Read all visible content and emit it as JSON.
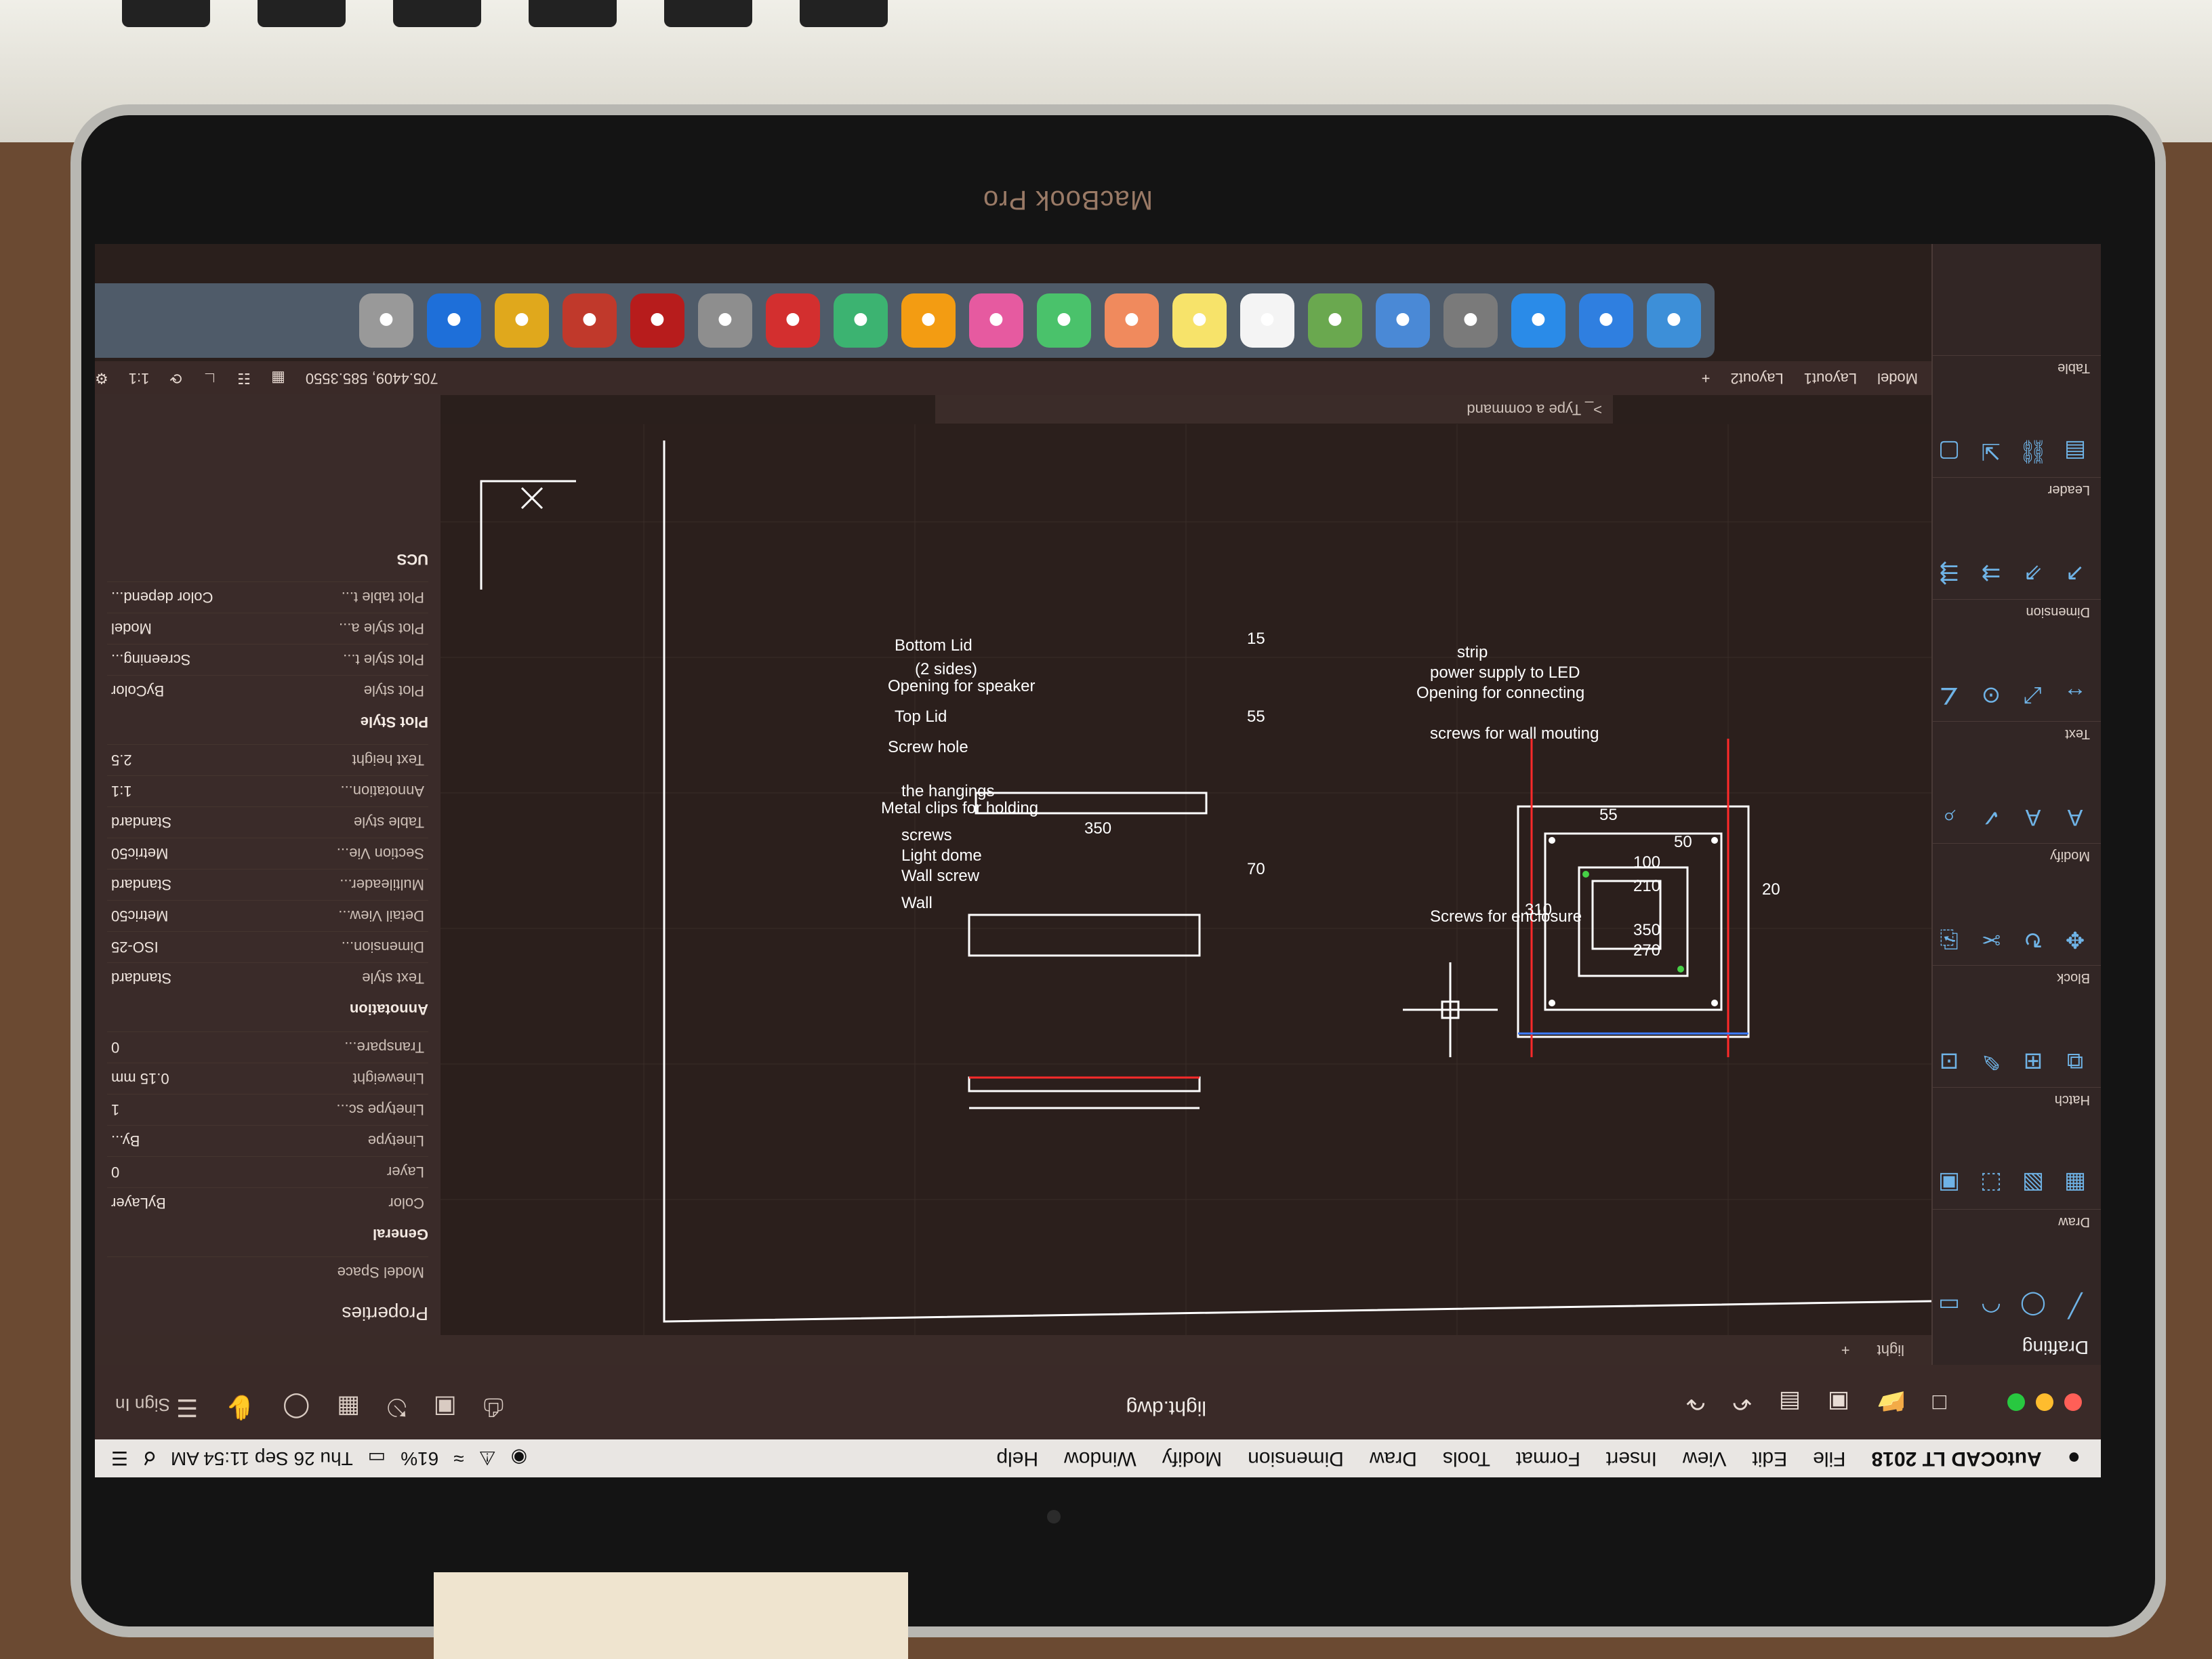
{
  "laptop": {
    "brand": "MacBook Pro"
  },
  "menubar": {
    "apple": "",
    "app_name": "AutoCAD LT 2018",
    "items": [
      "File",
      "Edit",
      "View",
      "Insert",
      "Format",
      "Tools",
      "Draw",
      "Dimension",
      "Modify",
      "Window",
      "Help"
    ],
    "battery": "61%",
    "clock": "Thu 26 Sep  11:54 AM"
  },
  "window": {
    "doc_title": "light.dwg",
    "workspace": "Drafting",
    "sign_in": "Sign In",
    "file_tab": "light"
  },
  "ribbon": {
    "groups": [
      {
        "label": "Draw",
        "icons": [
          "line-icon",
          "circle-icon",
          "arc-icon",
          "rectangle-icon"
        ]
      },
      {
        "label": "Hatch",
        "icons": [
          "hatch-icon",
          "gradient-icon",
          "boundary-icon",
          "region-icon"
        ]
      },
      {
        "label": "Block",
        "icons": [
          "insert-block-icon",
          "create-block-icon",
          "edit-block-icon",
          "attribute-icon"
        ]
      },
      {
        "label": "Modify",
        "icons": [
          "move-icon",
          "rotate-icon",
          "trim-icon",
          "copy-icon"
        ]
      },
      {
        "label": "Text",
        "icons": [
          "text-icon",
          "mtext-icon",
          "spell-icon",
          "find-icon"
        ]
      },
      {
        "label": "Dimension",
        "icons": [
          "linear-dim-icon",
          "aligned-dim-icon",
          "radius-dim-icon",
          "angular-dim-icon"
        ]
      },
      {
        "label": "Leader",
        "icons": [
          "leader-icon",
          "multileader-icon",
          "align-leader-icon",
          "collect-leader-icon"
        ]
      },
      {
        "label": "Table",
        "icons": [
          "table-icon",
          "data-link-icon",
          "extract-icon",
          "field-icon"
        ]
      }
    ]
  },
  "doc_tabs": [
    "Model",
    "Layout1",
    "Layout2"
  ],
  "command": {
    "placeholder": "Type a command"
  },
  "statusbar": {
    "coords": "705.4409, 585.3550",
    "scale": "1:1"
  },
  "properties": {
    "title": "Properties",
    "selection": "Model Space",
    "general": {
      "heading": "General",
      "rows": [
        {
          "k": "Color",
          "v": "ByLayer"
        },
        {
          "k": "Layer",
          "v": "0"
        },
        {
          "k": "Linetype",
          "v": "By..."
        },
        {
          "k": "Linetype sc...",
          "v": "1"
        },
        {
          "k": "Lineweight",
          "v": "0.15 mm"
        },
        {
          "k": "Transpare...",
          "v": "0"
        }
      ]
    },
    "annotation": {
      "heading": "Annotation",
      "rows": [
        {
          "k": "Text style",
          "v": "Standard"
        },
        {
          "k": "Dimension...",
          "v": "ISO-25"
        },
        {
          "k": "Detail View...",
          "v": "Metric50"
        },
        {
          "k": "Multileader...",
          "v": "Standard"
        },
        {
          "k": "Section Vie...",
          "v": "Metric50"
        },
        {
          "k": "Table style",
          "v": "Standard"
        },
        {
          "k": "Annotation...",
          "v": "1:1"
        },
        {
          "k": "Text height",
          "v": "2.5"
        }
      ]
    },
    "plot_style": {
      "heading": "Plot Style",
      "rows": [
        {
          "k": "Plot style",
          "v": "ByColor"
        },
        {
          "k": "Plot style t...",
          "v": "Screening..."
        },
        {
          "k": "Plot style a...",
          "v": "Model"
        },
        {
          "k": "Plot table t...",
          "v": "Color depend..."
        }
      ]
    },
    "ucs": {
      "heading": "UCS"
    }
  },
  "drawing": {
    "left_labels": {
      "bottom_lid": "Bottom Lid",
      "speaker_opening": "Opening for speaker",
      "two_sides": "(2 sides)",
      "top_lid": "Top Lid",
      "screw_hole": "Screw hole",
      "metal_clips": "Metal clips for holding",
      "the_hangings": "the hangings",
      "screws": "screws",
      "light_dome": "Light dome",
      "wall_screw": "Wall screw",
      "wall": "Wall"
    },
    "left_dims": {
      "d15": "15",
      "d55": "55",
      "d350": "350",
      "d70": "70"
    },
    "right_labels": {
      "strip": "strip",
      "power_supply": "power supply to LED",
      "opening_connecting": "Opening for connecting",
      "screws_wall": "screws for wall mouting",
      "screws_enclosure": "Screws for enclosure"
    },
    "right_dims": {
      "d55": "55",
      "d50": "50",
      "d100": "100",
      "d210": "210",
      "d20": "20",
      "d310": "310",
      "d350": "350",
      "d270": "270"
    }
  },
  "dock": {
    "apps": [
      "finder-icon",
      "appstore-icon",
      "safari-icon",
      "launchpad-icon",
      "preview-icon",
      "maps-icon",
      "calendar-icon",
      "notes-icon",
      "photos-icon",
      "messages-icon",
      "itunes-icon",
      "ibooks-icon",
      "facetime-icon",
      "acrobat-icon",
      "settings-icon",
      "autocad-icon",
      "fontforge-icon",
      "chrome-icon",
      "teamviewer-icon",
      "trash-icon"
    ]
  },
  "colors": {
    "canvas": "#2b1f1c",
    "line": "#ffffff",
    "red_line": "#ff2a2a",
    "blue_line": "#3d7bff",
    "green_dot": "#46d046",
    "icon_blue": "#6fb3e6"
  }
}
